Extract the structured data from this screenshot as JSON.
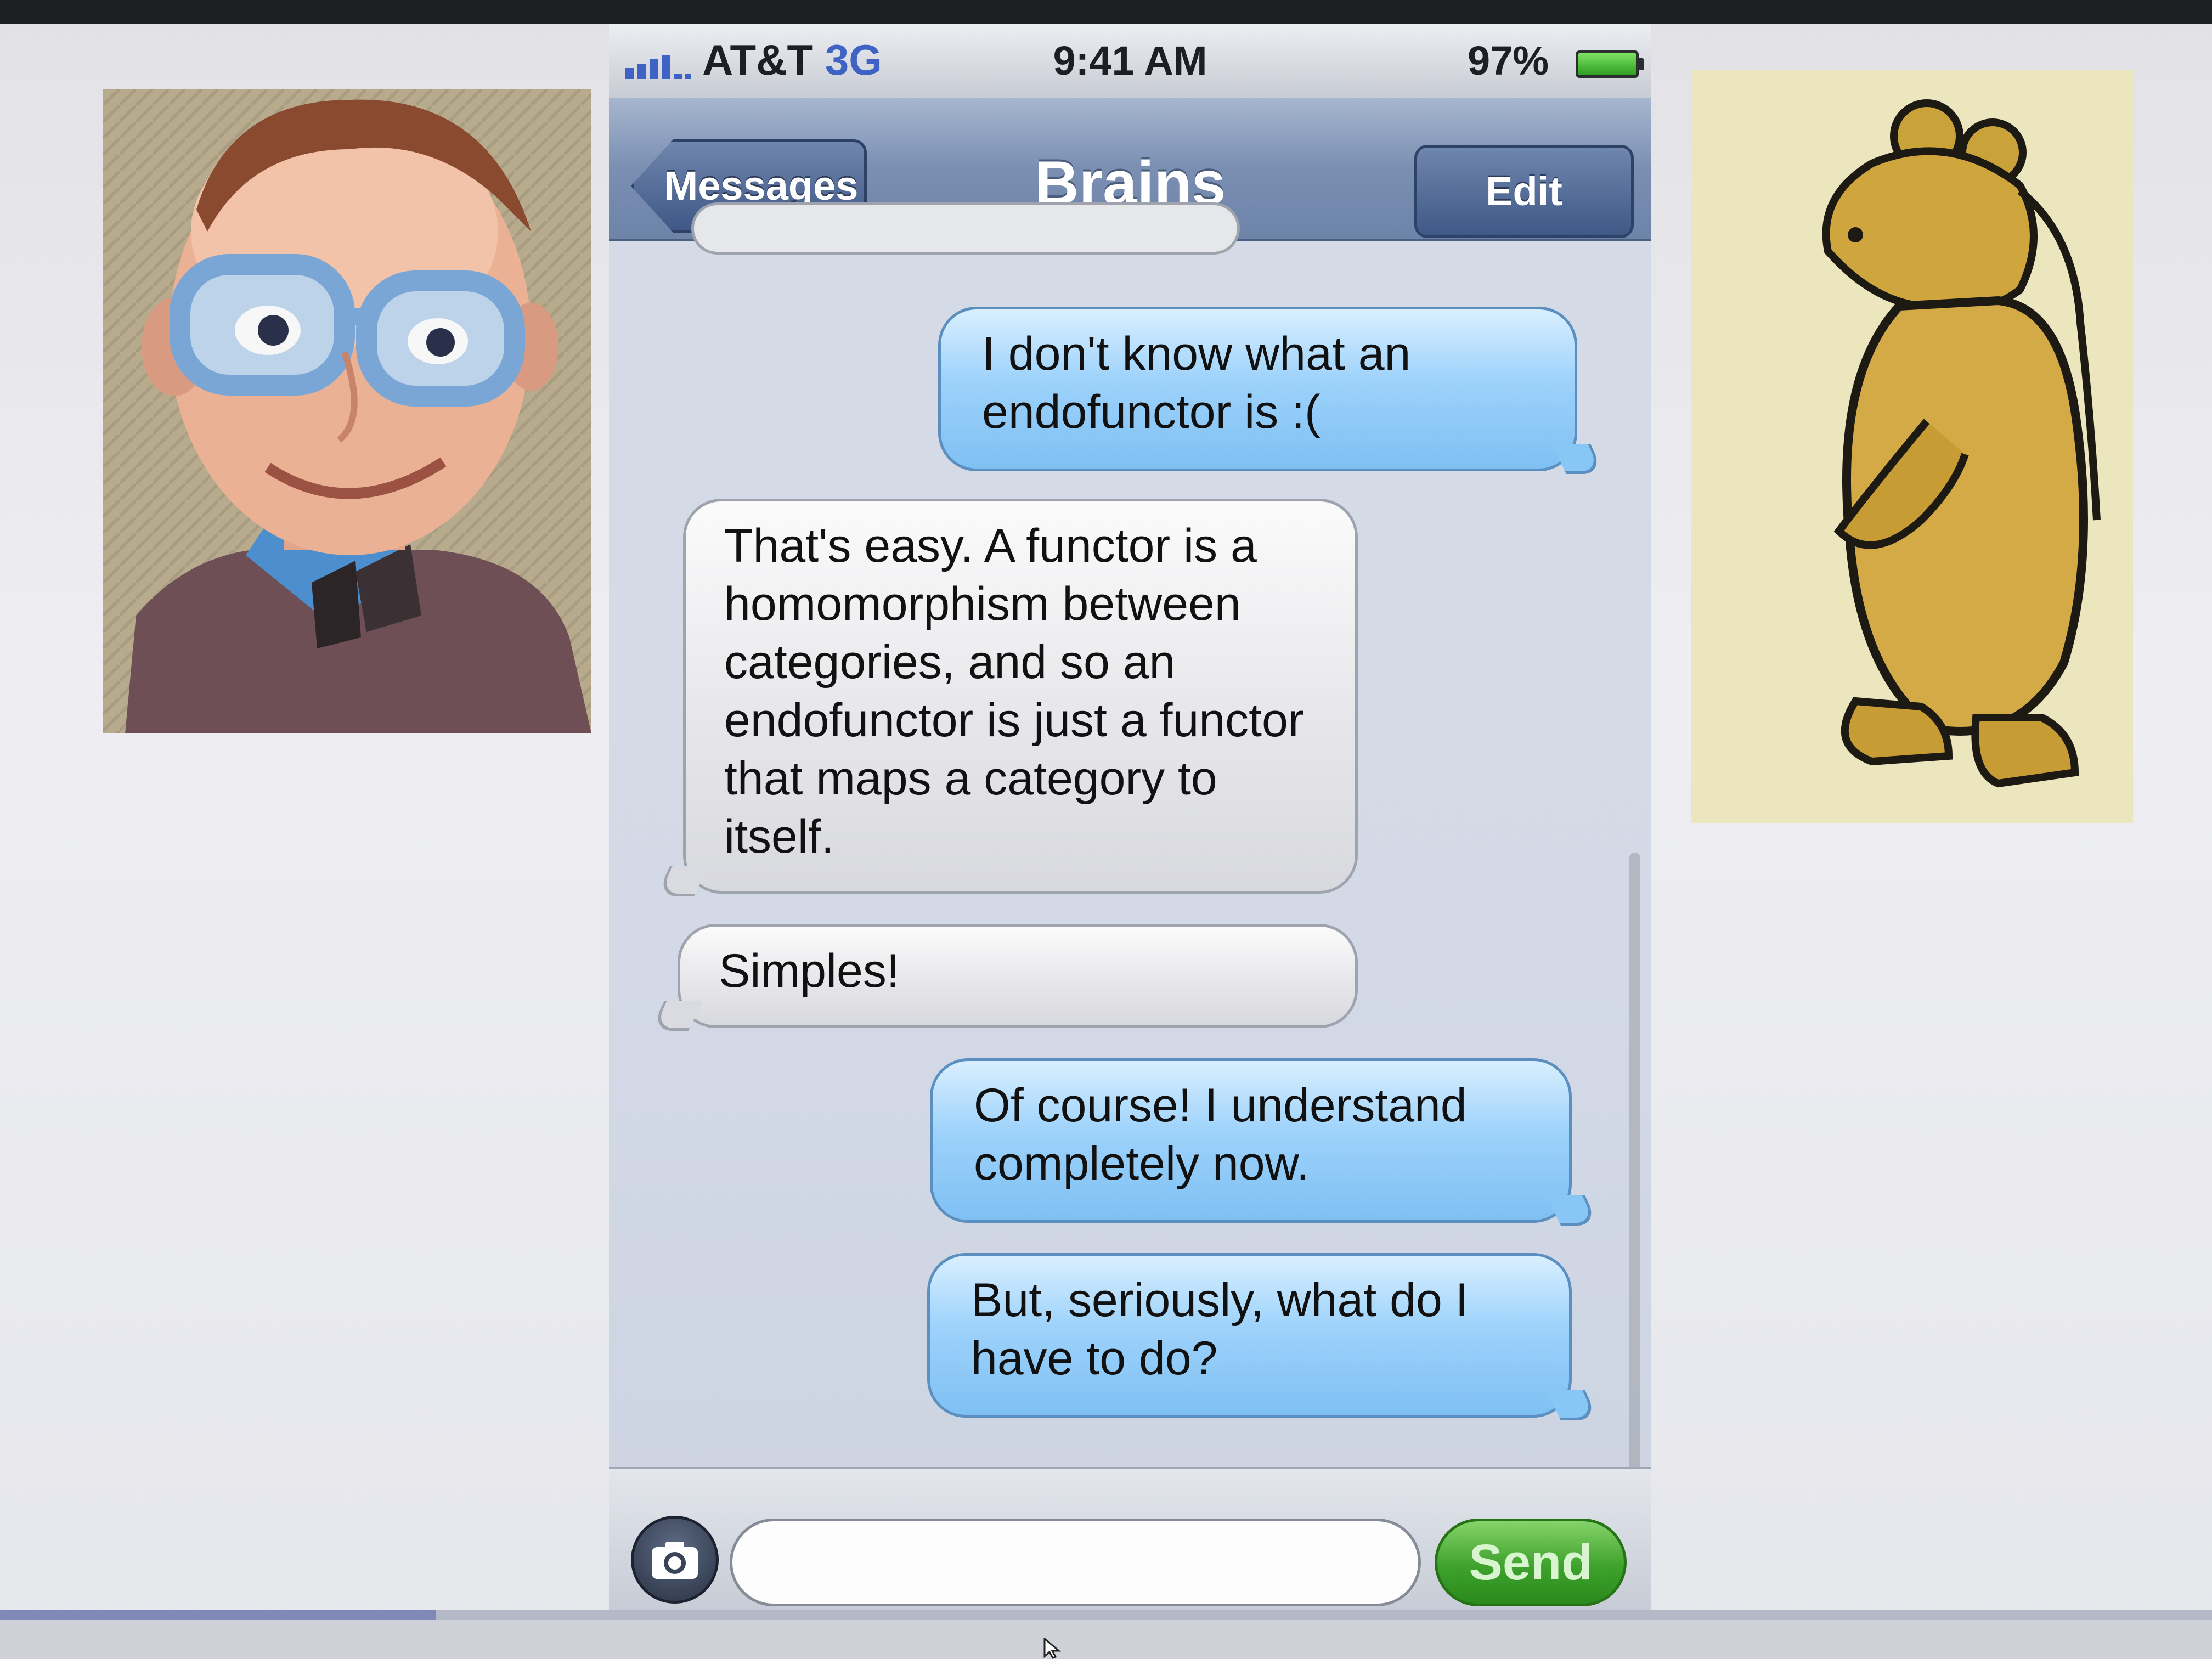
{
  "status_bar": {
    "carrier": "AT&T",
    "network": "3G",
    "time": "9:41 AM",
    "battery": "97%",
    "battery_level": 0.97
  },
  "nav": {
    "back_label": "Messages",
    "title": "Brains",
    "edit_label": "Edit"
  },
  "messages": [
    {
      "direction": "sent",
      "text_lines": [
        "I don't know what an",
        "endofunctor is :("
      ]
    },
    {
      "direction": "received",
      "text_lines": [
        "That's easy. A functor is a",
        "homomorphism between",
        "categories, and so an",
        "endofunctor is just a functor",
        "that maps a category to",
        "itself."
      ]
    },
    {
      "direction": "received",
      "text_lines": [
        "Simples!"
      ]
    },
    {
      "direction": "sent",
      "text_lines": [
        "Of course! I understand",
        "completely now."
      ]
    },
    {
      "direction": "sent",
      "text_lines": [
        "But, seriously, what do I",
        "have to do?"
      ]
    }
  ],
  "compose": {
    "input_value": "",
    "send_label": "Send"
  },
  "icons": {
    "signal": "signal-bars-icon",
    "battery": "battery-icon",
    "camera": "camera-icon",
    "back": "chevron-left-icon",
    "cursor": "mouse-pointer-icon"
  },
  "colors": {
    "nav_bar": "#7a8fb2",
    "sent_bubble": "#9dd2fb",
    "received_bubble": "#e7e7eb",
    "send_button": "#3ea22c",
    "network_label": "#3f63c4",
    "battery_fill": "#2d9d21"
  },
  "side_images": {
    "left": "puppet-with-glasses-photo",
    "right": "bear-illustration"
  },
  "page_progress": 0.2
}
